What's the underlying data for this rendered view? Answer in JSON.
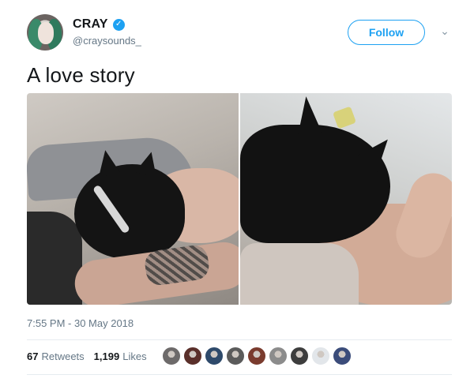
{
  "user": {
    "display_name": "CRAY",
    "verified_glyph": "✓",
    "handle": "@craysounds_"
  },
  "follow_label": "Follow",
  "more_glyph": "⌄",
  "tweet_text": "A love story",
  "timestamp": "7:55 PM - 30 May 2018",
  "stats": {
    "retweets_count": "67",
    "retweets_label": "Retweets",
    "likes_count": "1,199",
    "likes_label": "Likes"
  },
  "likers": [
    {
      "color": "#6d6a6a"
    },
    {
      "color": "#5a2f2a"
    },
    {
      "color": "#2e4a6b"
    },
    {
      "color": "#5b5b5b"
    },
    {
      "color": "#7a3b2e"
    },
    {
      "color": "#8c8c8c"
    },
    {
      "color": "#3d3d3d"
    },
    {
      "color": "#e2e6ea"
    },
    {
      "color": "#3b4c7a"
    }
  ],
  "colors": {
    "brand_blue": "#1da1f2",
    "secondary_text": "#657786"
  }
}
